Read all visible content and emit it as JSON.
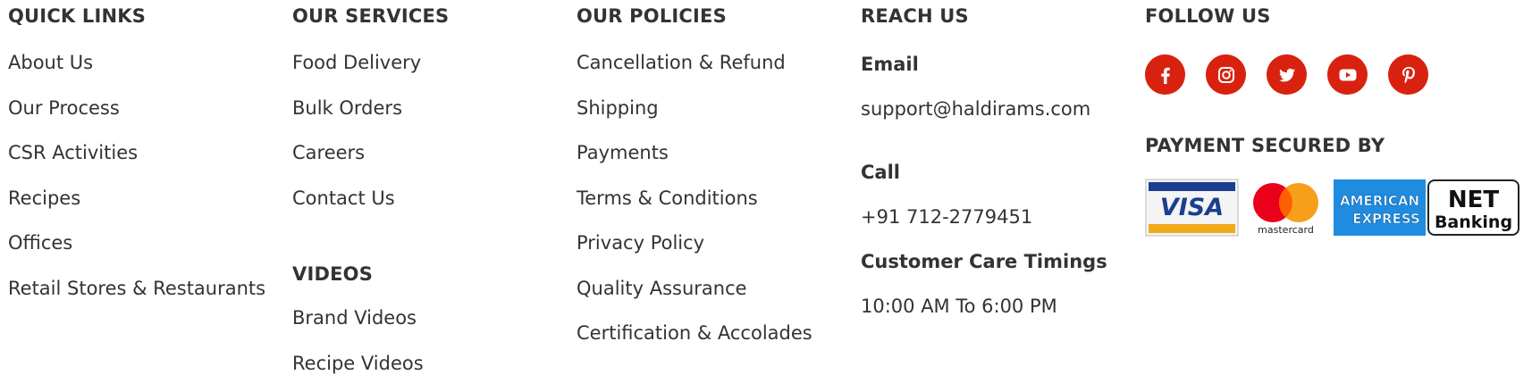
{
  "quick_links": {
    "heading": "QUICK LINKS",
    "items": [
      "About Us",
      "Our Process",
      "CSR Activities",
      "Recipes",
      "Offices",
      "Retail Stores & Restaurants"
    ]
  },
  "services": {
    "heading": "OUR SERVICES",
    "items": [
      "Food Delivery",
      "Bulk Orders",
      "Careers",
      "Contact Us"
    ]
  },
  "videos": {
    "heading": "VIDEOS",
    "items": [
      "Brand Videos",
      "Recipe Videos"
    ]
  },
  "policies": {
    "heading": "OUR POLICIES",
    "items": [
      "Cancellation & Refund",
      "Shipping",
      "Payments",
      "Terms & Conditions",
      "Privacy Policy",
      "Quality Assurance",
      "Certification & Accolades"
    ]
  },
  "reach": {
    "heading": "REACH US",
    "email_label": "Email",
    "email": "support@haldirams.com",
    "call_label": "Call",
    "phone": "+91 712-2779451",
    "timings_label": "Customer Care Timings",
    "timings": "10:00 AM To 6:00 PM"
  },
  "follow": {
    "heading": "FOLLOW US",
    "icons": [
      "facebook-icon",
      "instagram-icon",
      "twitter-icon",
      "youtube-icon",
      "pinterest-icon"
    ],
    "accent_color": "#d8220f"
  },
  "payment": {
    "heading": "PAYMENT SECURED BY",
    "logos": {
      "visa": "VISA",
      "mastercard": "mastercard",
      "amex_line1": "AMERICAN",
      "amex_line2": "EXPRESS",
      "netbanking_line1": "NET",
      "netbanking_line2": "Banking"
    }
  }
}
